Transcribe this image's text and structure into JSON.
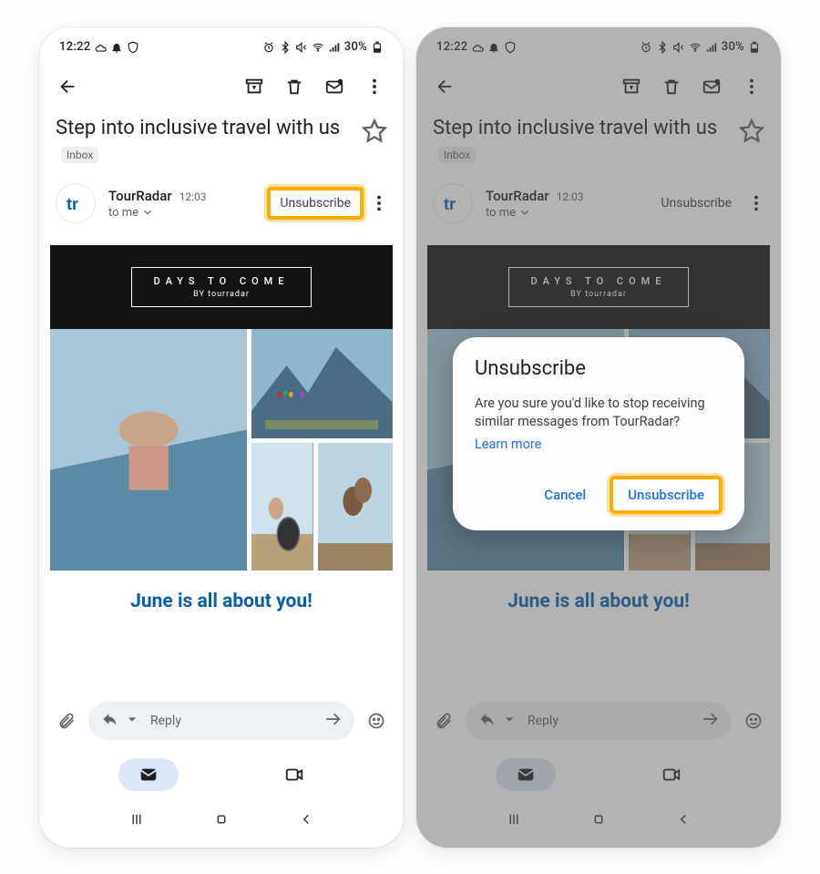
{
  "status": {
    "time": "12:22",
    "battery": "30%"
  },
  "email": {
    "subject": "Step into inclusive travel with us",
    "label": "Inbox",
    "sender": "TourRadar",
    "sender_time": "12:03",
    "recipient": "to me",
    "unsubscribe": "Unsubscribe",
    "hero_title": "DAYS TO COME",
    "hero_sub": "BY tourradar",
    "headline": "June is all about you!"
  },
  "reply": {
    "placeholder": "Reply"
  },
  "dialog": {
    "title": "Unsubscribe",
    "body": "Are you sure you'd like to stop receiving similar messages from TourRadar?",
    "learn_more": "Learn more",
    "cancel": "Cancel",
    "confirm": "Unsubscribe"
  },
  "chart_data": null
}
